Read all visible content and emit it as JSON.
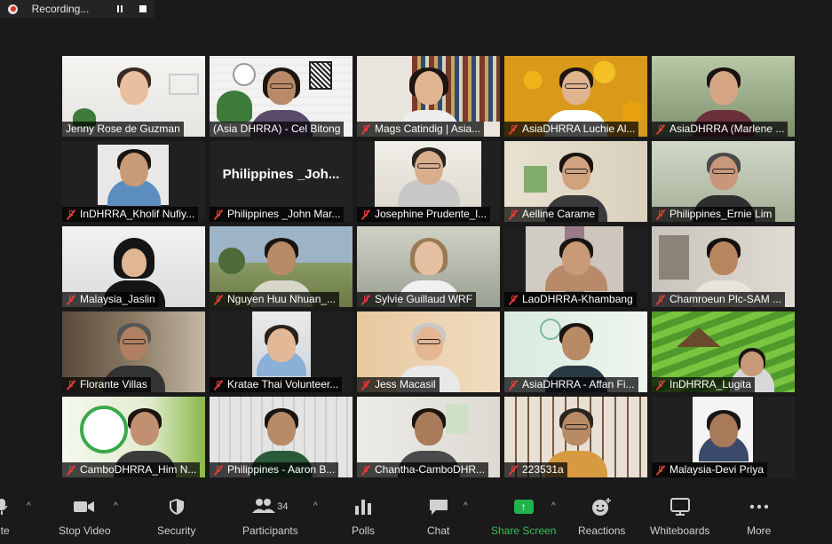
{
  "recording": {
    "label": "Recording...",
    "pause_icon": "pause-icon",
    "stop_icon": "stop-icon"
  },
  "colors": {
    "background": "#1a1a1a",
    "active_speaker_border": "#e6f06a",
    "muted_icon": "#e23b3b",
    "share_screen": "#22b24c"
  },
  "participants": [
    {
      "name": "Jenny Rose de Guzman",
      "muted": false
    },
    {
      "name": "(Asia DHRRA) - Cel Bitong",
      "muted": false,
      "active": true
    },
    {
      "name": "Mags Catindig | Asia...",
      "muted": true
    },
    {
      "name": "AsiaDHRRA Luchie Al...",
      "muted": true
    },
    {
      "name": "AsiaDHRRA (Marlene ...",
      "muted": true
    },
    {
      "name": "InDHRRA_Kholif Nufiy...",
      "muted": true
    },
    {
      "name": "Philippines _John Mar...",
      "muted": true,
      "video_off_label": "Philippines  _Joh..."
    },
    {
      "name": "Josephine Prudente_l...",
      "muted": true
    },
    {
      "name": "Aelline Carame",
      "muted": true
    },
    {
      "name": "Philippines_Ernie Lim",
      "muted": true
    },
    {
      "name": "Malaysia_Jaslin",
      "muted": true
    },
    {
      "name": "Nguyen Huu Nhuan_...",
      "muted": true
    },
    {
      "name": "Sylvie Guillaud WRF",
      "muted": true
    },
    {
      "name": "LaoDHRRA-Khambang",
      "muted": true
    },
    {
      "name": "Chamroeun Plc-SAM ...",
      "muted": true
    },
    {
      "name": "Florante Villas",
      "muted": true
    },
    {
      "name": "Kratae Thai Volunteer...",
      "muted": true
    },
    {
      "name": "Jess Macasil",
      "muted": true
    },
    {
      "name": "AsiaDHRRA - Affan Fi...",
      "muted": true
    },
    {
      "name": "InDHRRA_Lugita",
      "muted": true
    },
    {
      "name": "CamboDHRRA_Him N...",
      "muted": true
    },
    {
      "name": "Philippines - Aaron B...",
      "muted": true
    },
    {
      "name": "Chantha-CamboDHR...",
      "muted": true
    },
    {
      "name": "223531a",
      "muted": true
    },
    {
      "name": "Malaysia-Devi Priya",
      "muted": true
    }
  ],
  "toolbar": {
    "mute": "ute",
    "stop_video": "Stop Video",
    "security": "Security",
    "participants": "Participants",
    "participants_count": "34",
    "polls": "Polls",
    "chat": "Chat",
    "share_screen": "Share Screen",
    "reactions": "Reactions",
    "whiteboards": "Whiteboards",
    "more": "More"
  }
}
